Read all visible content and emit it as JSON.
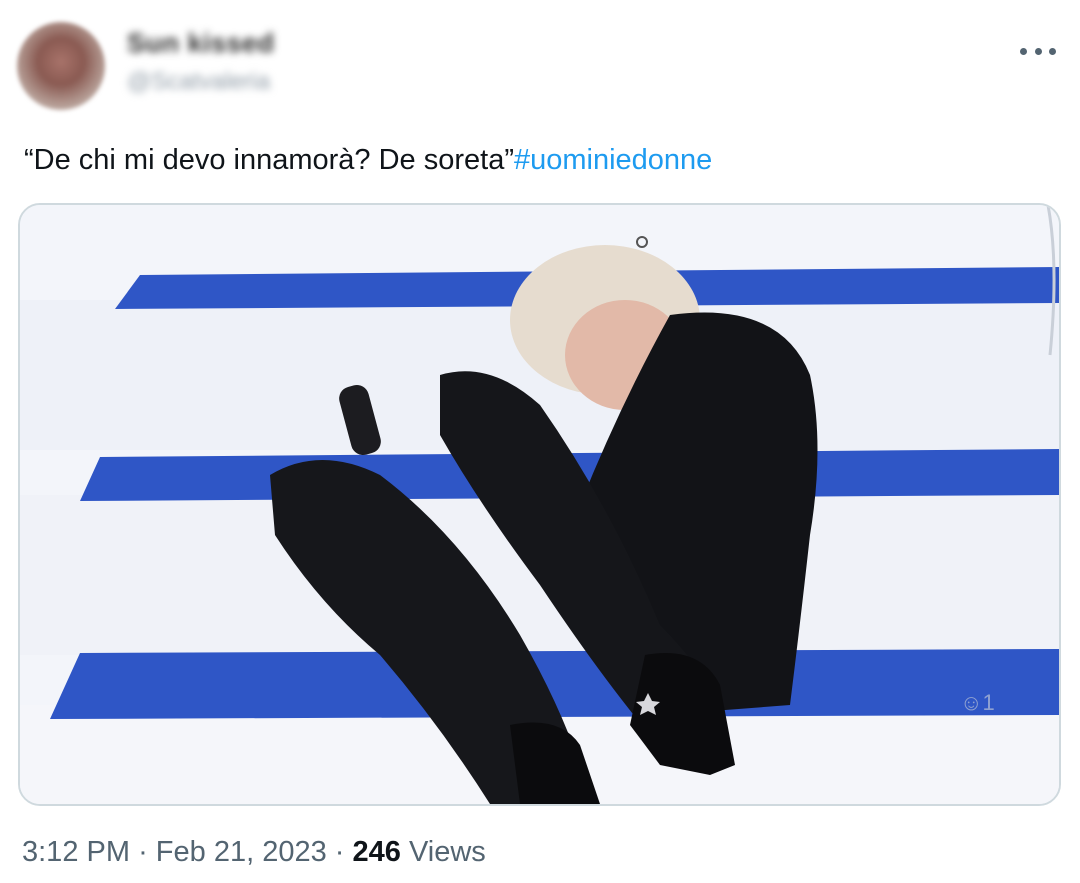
{
  "author": {
    "display_name": "Sun kissed",
    "handle": "@Scatvaleria"
  },
  "tweet": {
    "text": "“De chi mi devo innamorà? De soreta”",
    "hashtag": "#uominiedonne"
  },
  "meta": {
    "time": "3:12 PM",
    "separator": "·",
    "date": "Feb 21, 2023",
    "views_count": "246",
    "views_label": "Views"
  },
  "icons": {
    "more": "more-horizontal-icon"
  },
  "colors": {
    "link": "#1d9bf0",
    "text": "#0f1419",
    "secondary": "#536471",
    "stripe_blue": "#2f56c6"
  }
}
